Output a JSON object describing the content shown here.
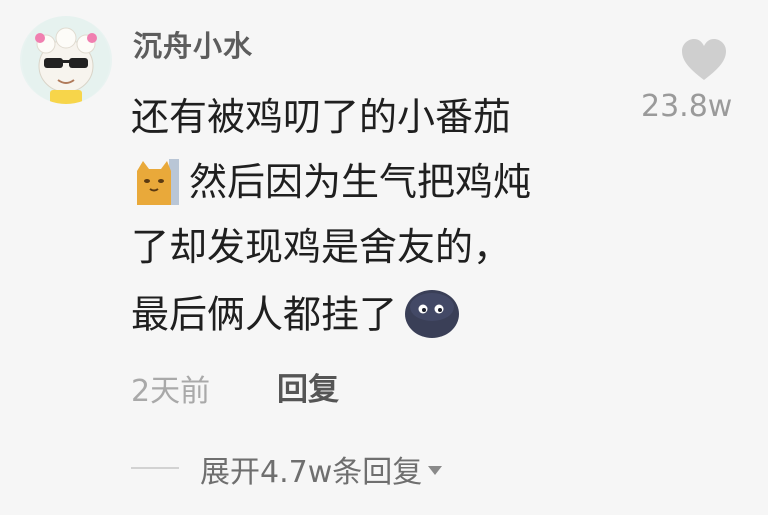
{
  "comment": {
    "author": "沉舟小水",
    "like_count": "23.8w",
    "lines": [
      "还有被鸡叨了的小番茄",
      "然后因为生气把鸡炖",
      "了却发现鸡是舍友的，",
      "最后俩人都挂了"
    ],
    "inline_emojis": [
      "cat-emoji",
      "dark-blob-emoji"
    ],
    "timestamp": "2天前",
    "reply_label": "回复",
    "expand_replies_label": "展开4.7w条回复"
  },
  "icons": {
    "like": "heart-icon",
    "expand": "caret-down-icon"
  },
  "colors": {
    "background": "#f6f6f6",
    "text_primary": "#1f1f1f",
    "text_secondary": "#9a9a9a",
    "heart": "#cfcfcf"
  }
}
